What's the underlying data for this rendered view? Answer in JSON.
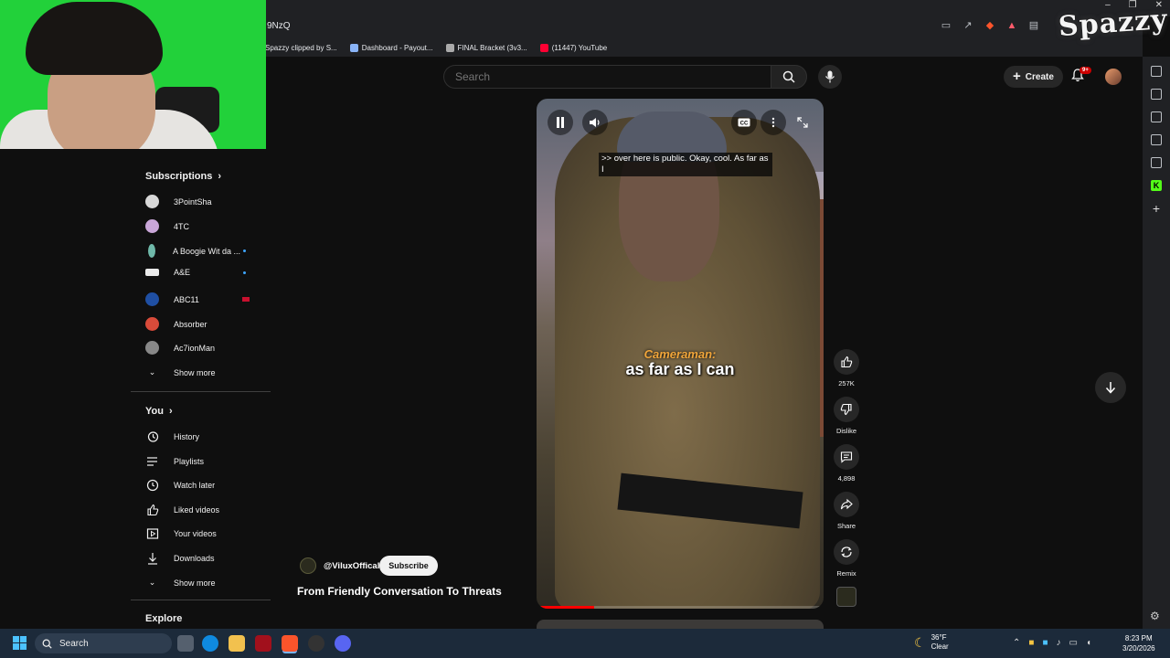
{
  "browser": {
    "url_text": "9NzQ",
    "bookmarks": [
      {
        "label": "Spazzy clipped by S..."
      },
      {
        "label": "Dashboard - Payout..."
      },
      {
        "label": "FINAL Bracket (3v3..."
      },
      {
        "label": "(11447) YouTube"
      }
    ]
  },
  "overlay": {
    "logo_text": "Spazzy"
  },
  "youtube": {
    "search_placeholder": "Search",
    "create_label": "Create",
    "notif_badge": "9+"
  },
  "guide": {
    "subscriptions_title": "Subscriptions",
    "subscriptions": [
      {
        "label": "3PointSha",
        "color": "#d8d8d8"
      },
      {
        "label": "4TC",
        "color": "#c9a6d8"
      },
      {
        "label": "A Boogie Wit da ...",
        "color": "#6fb8a9"
      },
      {
        "label": "A&E",
        "color": "#eaeaea"
      },
      {
        "label": "ABC11",
        "color": "#1f4fa3"
      },
      {
        "label": "Absorber",
        "color": "#d94b3a"
      },
      {
        "label": "Ac7ionMan",
        "color": "#888888"
      }
    ],
    "show_more_1": "Show more",
    "you_title": "You",
    "you_items": [
      {
        "label": "History",
        "icon": "history-icon"
      },
      {
        "label": "Playlists",
        "icon": "playlists-icon"
      },
      {
        "label": "Watch later",
        "icon": "watch-later-icon"
      },
      {
        "label": "Liked videos",
        "icon": "liked-icon"
      },
      {
        "label": "Your videos",
        "icon": "your-videos-icon"
      },
      {
        "label": "Downloads",
        "icon": "downloads-icon"
      }
    ],
    "show_more_2": "Show more",
    "explore_title": "Explore"
  },
  "short": {
    "caption_line": ">> over here is public. Okay, cool. As far as I",
    "subtitle_speaker": "Cameraman:",
    "subtitle_text": "as far as I can",
    "progress": 0.2,
    "channel_name": "@ViluxOffical",
    "subscribe_label": "Subscribe",
    "title": "From Friendly Conversation To Threats",
    "actions": {
      "likes": "257K",
      "dislike": "Dislike",
      "comments": "4,898",
      "share": "Share",
      "remix": "Remix"
    }
  },
  "taskbar": {
    "search_label": "Search",
    "temp": "36°F",
    "weather": "Clear",
    "time": "8:23 PM",
    "date": "3/20/2026"
  }
}
